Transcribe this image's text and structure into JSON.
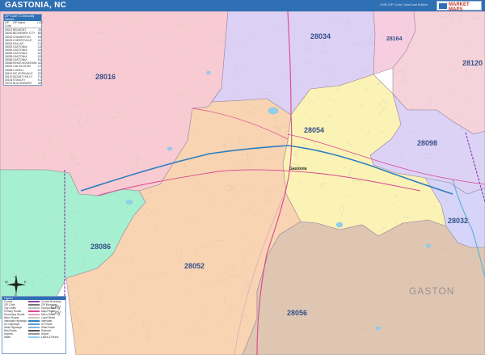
{
  "map": {
    "title": "GASTONIA, NC",
    "edition": "2026 ZIP Code ColorCast Edition",
    "brand": "MARKET MAPS",
    "zip_areas": [
      {
        "zip": "28034",
        "color": "#ddd0f5"
      },
      {
        "zip": "28164",
        "color": "#f7cde0"
      },
      {
        "zip": "28120",
        "color": "#f6d3da"
      },
      {
        "zip": "28016",
        "color": "#f8cbd3"
      },
      {
        "zip": "28054",
        "color": "#fbf2b6"
      },
      {
        "zip": "28098",
        "color": "#dcd2f6"
      },
      {
        "zip": "28032",
        "color": "#d6d4f8"
      },
      {
        "zip": "28086",
        "color": "#a6efd0"
      },
      {
        "zip": "28052",
        "color": "#f8d4b2"
      },
      {
        "zip": "28056",
        "color": "#dfc6b2"
      }
    ],
    "city_label": "Gastonia",
    "county_label": "GASTON",
    "colors": {
      "highway": "#2f7fbf",
      "primary_road": "#d9468f",
      "water": "#8fd0ee",
      "county_line": "#8e44ad"
    }
  },
  "zip_list": {
    "header": "ZIP Code / Community Names",
    "columns": [
      "ZIP Code",
      "ZIP Name",
      "LOC"
    ],
    "rows": [
      [
        "28012",
        "BELMONT",
        "26"
      ],
      [
        "28016",
        "BESSEMER CITY",
        "B3"
      ],
      [
        "28032",
        "CRAMERTON",
        "E5"
      ],
      [
        "28033",
        "CHERRYVILLE",
        "A1"
      ],
      [
        "28034",
        "DALLAS",
        "C1"
      ],
      [
        "28052",
        "GASTONIA",
        "C4"
      ],
      [
        "28053",
        "GASTONIA",
        "D3"
      ],
      [
        "28054",
        "GASTONIA",
        "D2"
      ],
      [
        "28055",
        "GASTONIA",
        "D3"
      ],
      [
        "28056",
        "GASTONIA",
        "E4"
      ],
      [
        "28086",
        "KINGS MOUNTAIN",
        "A4"
      ],
      [
        "28092",
        "LINCOLNTON",
        "C1"
      ],
      [
        "28098",
        "LOWELL",
        "E2"
      ],
      [
        "28101",
        "MC ADENVILLE",
        "E2"
      ],
      [
        "28120",
        "MOUNT HOLLY",
        "F1"
      ],
      [
        "28164",
        "STANLEY",
        "E1"
      ],
      [
        "29702",
        "BLACKSBURG",
        "A5"
      ]
    ]
  },
  "legend": {
    "header": "Legend",
    "city_word": "City",
    "items": [
      {
        "name": "County",
        "desc": "County Boundary",
        "color": "#8e44ad"
      },
      {
        "name": "ZIP Code",
        "desc": "ZIP Boundary",
        "color": "#777777"
      },
      {
        "name": "City Limits",
        "desc": "Incorporated",
        "color": "#bbbbbb"
      },
      {
        "name": "Primary Roads",
        "desc": "Major Road",
        "color": "#d9468f"
      },
      {
        "name": "Secondary Roads",
        "desc": "Minor Road",
        "color": "#e8a0c0"
      },
      {
        "name": "Minor Roads",
        "desc": "Local Street",
        "color": "#cfc7b8"
      },
      {
        "name": "Interstate Highways",
        "desc": "Interstate",
        "color": "#2f7fbf"
      },
      {
        "name": "US Highways",
        "desc": "US Route",
        "color": "#5b9bd5"
      },
      {
        "name": "State Highways",
        "desc": "State Route",
        "color": "#7fb3de"
      },
      {
        "name": "Rail Roads",
        "desc": "Railroad",
        "color": "#555555"
      },
      {
        "name": "Airports",
        "desc": "Airport",
        "color": "#999999"
      },
      {
        "name": "Water",
        "desc": "Lakes & Rivers",
        "color": "#8fd0ee"
      }
    ]
  },
  "compass": {
    "north": "N",
    "south": "S",
    "east": "E",
    "west": "W"
  }
}
